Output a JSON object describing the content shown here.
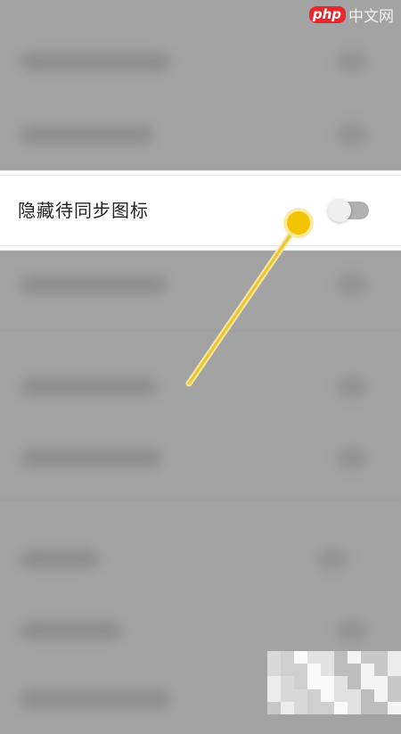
{
  "setting": {
    "label": "隐藏待同步图标",
    "enabled": false
  },
  "watermark": {
    "logo_text": "php",
    "site_text": "中文网"
  },
  "colors": {
    "overlay_gray": "#a3a3a3",
    "panel_white": "#ffffff",
    "gesture_yellow": "#f5c400",
    "toggle_track": "#b0b0b0",
    "toggle_knob": "#efefef",
    "logo_red": "#e8262b"
  },
  "icons": {
    "gesture": "tap-swipe-indicator-icon",
    "toggle": "toggle-switch-icon"
  }
}
